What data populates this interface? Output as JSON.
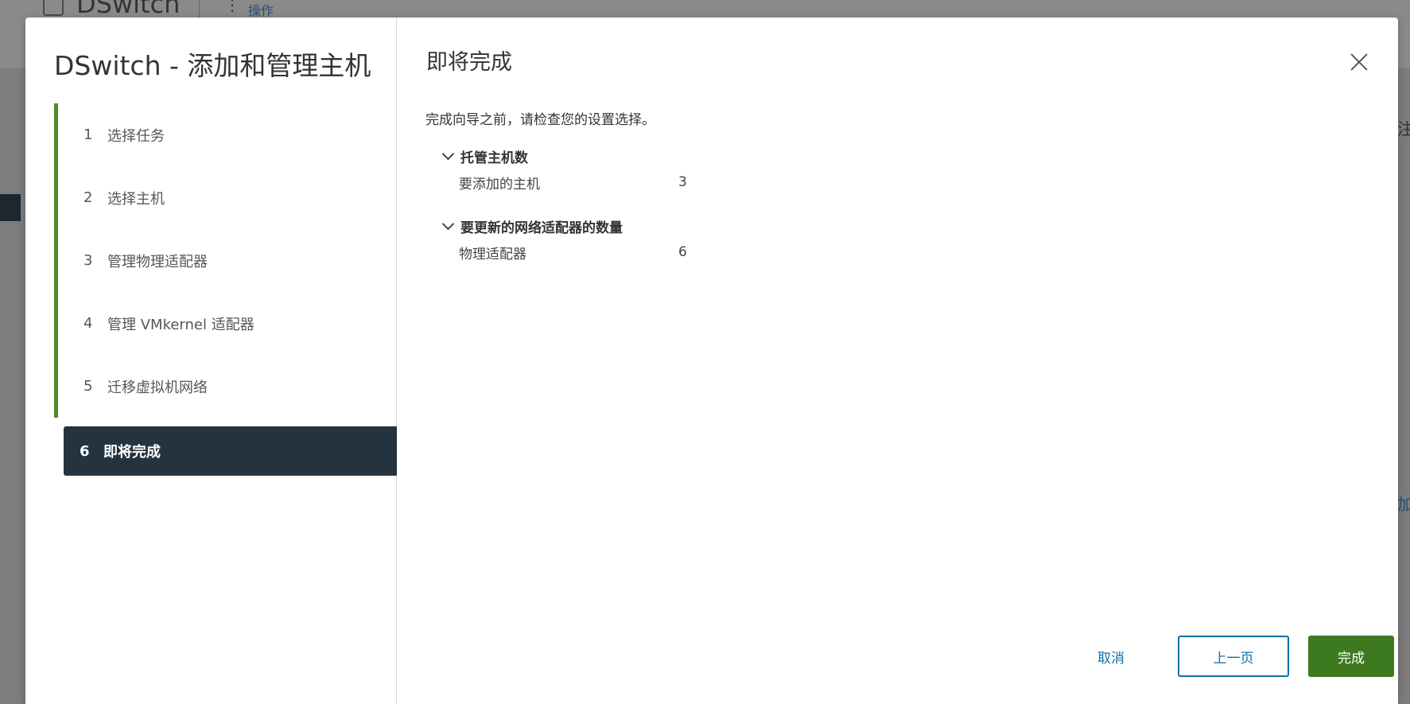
{
  "background": {
    "title": "DSwitch",
    "actions_label": "操作",
    "right_char_1": "注",
    "right_char_2": "加"
  },
  "wizard": {
    "title": "DSwitch - 添加和管理主机",
    "steps": [
      {
        "num": "1",
        "label": "选择任务"
      },
      {
        "num": "2",
        "label": "选择主机"
      },
      {
        "num": "3",
        "label": "管理物理适配器"
      },
      {
        "num": "4",
        "label": "管理 VMkernel 适配器"
      },
      {
        "num": "5",
        "label": "迁移虚拟机网络"
      },
      {
        "num": "6",
        "label": "即将完成"
      }
    ],
    "active_step": 6
  },
  "main": {
    "title": "即将完成",
    "intro": "完成向导之前，请检查您的设置选择。",
    "sections": [
      {
        "title": "托管主机数",
        "rows": [
          {
            "key": "要添加的主机",
            "value": "3"
          }
        ]
      },
      {
        "title": "要更新的网络适配器的数量",
        "rows": [
          {
            "key": "物理适配器",
            "value": "6"
          }
        ]
      }
    ]
  },
  "footer": {
    "cancel_label": "取消",
    "back_label": "上一页",
    "finish_label": "完成"
  },
  "colors": {
    "accent_green": "#3d7a1f",
    "step_bar": "#4e8a2a",
    "active_step_bg": "#25333e",
    "link_blue": "#0f6fa3"
  }
}
